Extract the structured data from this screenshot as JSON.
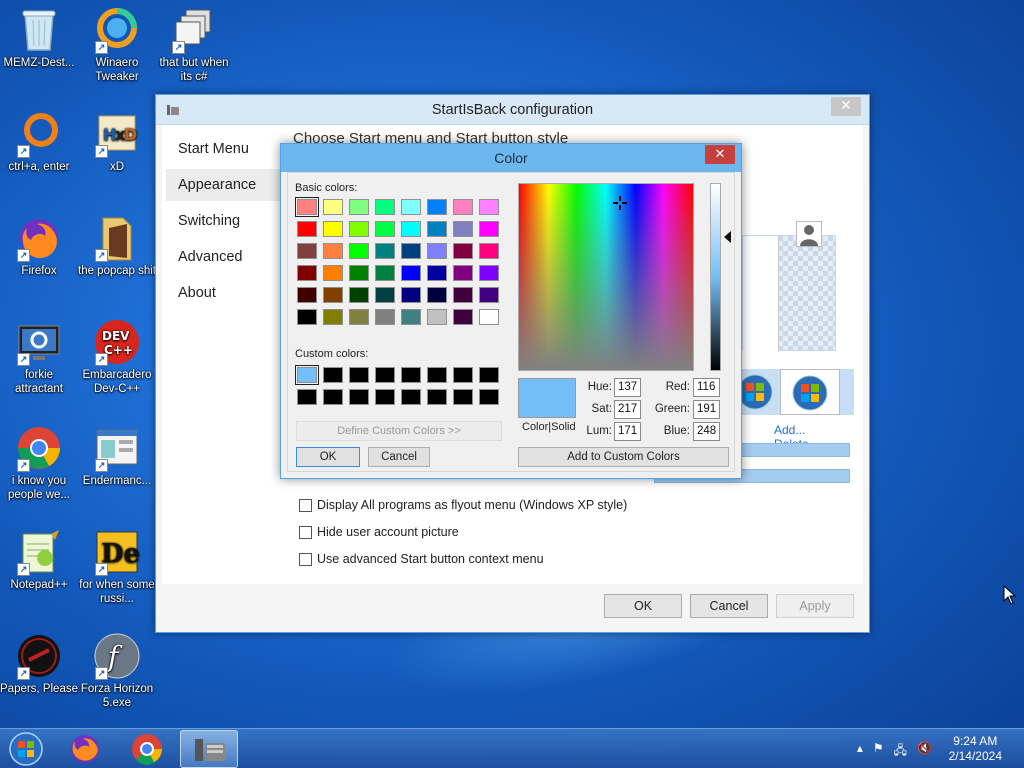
{
  "desktop": {
    "icons": [
      {
        "label": "MEMZ-Dest...",
        "icon": "recycle-bin-icon"
      },
      {
        "label": "Winaero Tweaker",
        "icon": "winaero-icon"
      },
      {
        "label": "that but when its c#",
        "icon": "window-stack-icon"
      },
      {
        "label": "ctrl+a, enter",
        "icon": "orange-ring-icon"
      },
      {
        "label": "xD",
        "icon": "hxd-icon"
      },
      {
        "label": "Firefox",
        "icon": "firefox-icon"
      },
      {
        "label": "the popcap shit",
        "icon": "folder-icon"
      },
      {
        "label": "forkie attractant",
        "icon": "gear-monitor-icon"
      },
      {
        "label": "Embarcadero Dev-C++",
        "icon": "devcpp-icon"
      },
      {
        "label": "i know you people we...",
        "icon": "chrome-icon"
      },
      {
        "label": "Endermanc...",
        "icon": "app-window-icon"
      },
      {
        "label": "Notepad++",
        "icon": "notepadpp-icon"
      },
      {
        "label": "for when some russi...",
        "icon": "de-icon"
      },
      {
        "label": "Papers, Please",
        "icon": "papers-please-icon"
      },
      {
        "label": "Forza Horizon 5.exe",
        "icon": "flash-icon"
      }
    ]
  },
  "window": {
    "title": "StartIsBack configuration",
    "close_glyph": "✕",
    "nav": [
      "Start Menu",
      "Appearance",
      "Switching",
      "Advanced",
      "About"
    ],
    "heading": "Choose Start menu and Start button style",
    "orb_links": {
      "add": "Add...",
      "delete": "Delete"
    },
    "checkboxes": [
      "Display All programs as flyout menu (Windows XP style)",
      "Hide user account picture",
      "Use advanced Start button context menu"
    ],
    "buttons": {
      "ok": "OK",
      "cancel": "Cancel",
      "apply": "Apply"
    }
  },
  "color_dialog": {
    "title": "Color",
    "close_glyph": "✕",
    "basic_label": "Basic colors:",
    "custom_label": "Custom colors:",
    "basic_colors": [
      "#ff8080",
      "#ffff80",
      "#80ff80",
      "#00ff80",
      "#80ffff",
      "#0080ff",
      "#ff80c0",
      "#ff80ff",
      "#ff0000",
      "#ffff00",
      "#80ff00",
      "#00ff40",
      "#00ffff",
      "#0080c0",
      "#8080c0",
      "#ff00ff",
      "#804040",
      "#ff8040",
      "#00ff00",
      "#008080",
      "#004080",
      "#8080ff",
      "#800040",
      "#ff0080",
      "#800000",
      "#ff8000",
      "#008000",
      "#008040",
      "#0000ff",
      "#0000a0",
      "#800080",
      "#8000ff",
      "#400000",
      "#804000",
      "#004000",
      "#004040",
      "#000080",
      "#000040",
      "#400040",
      "#400080",
      "#000000",
      "#808000",
      "#808040",
      "#808080",
      "#408080",
      "#c0c0c0",
      "#400040",
      "#ffffff"
    ],
    "custom_colors": [
      "#74bff8",
      "#000000",
      "#000000",
      "#000000",
      "#000000",
      "#000000",
      "#000000",
      "#000000",
      "#000000",
      "#000000",
      "#000000",
      "#000000",
      "#000000",
      "#000000",
      "#000000",
      "#000000"
    ],
    "define_button": "Define Custom Colors >>",
    "ok": "OK",
    "cancel": "Cancel",
    "color_solid_label": "Color|Solid",
    "fields": {
      "hue_label": "Hue:",
      "hue": "137",
      "sat_label": "Sat:",
      "sat": "217",
      "lum_label": "Lum:",
      "lum": "171",
      "red_label": "Red:",
      "red": "116",
      "green_label": "Green:",
      "green": "191",
      "blue_label": "Blue:",
      "blue": "248"
    },
    "add_custom_button": "Add to Custom Colors",
    "selected_color": "#74bff8"
  },
  "taskbar": {
    "time": "9:24 AM",
    "date": "2/14/2024"
  }
}
